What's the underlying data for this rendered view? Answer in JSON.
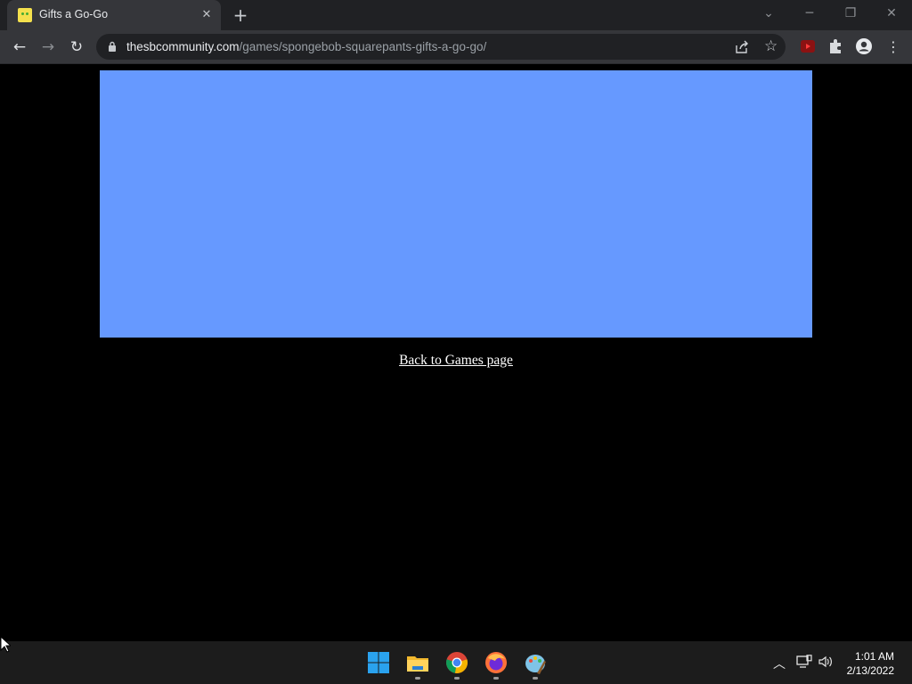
{
  "browser": {
    "tab_title": "Gifts a Go-Go",
    "url_host": "thesbcommunity.com",
    "url_path": "/games/spongebob-squarepants-gifts-a-go-go/"
  },
  "page": {
    "game_bg_color": "#6699ff",
    "back_link_text": "Back to Games page"
  },
  "taskbar": {
    "apps": [
      "windows-start-icon",
      "file-explorer-icon",
      "chrome-icon",
      "firefox-icon",
      "paint-icon"
    ],
    "time": "1:01 AM",
    "date": "2/13/2022"
  }
}
